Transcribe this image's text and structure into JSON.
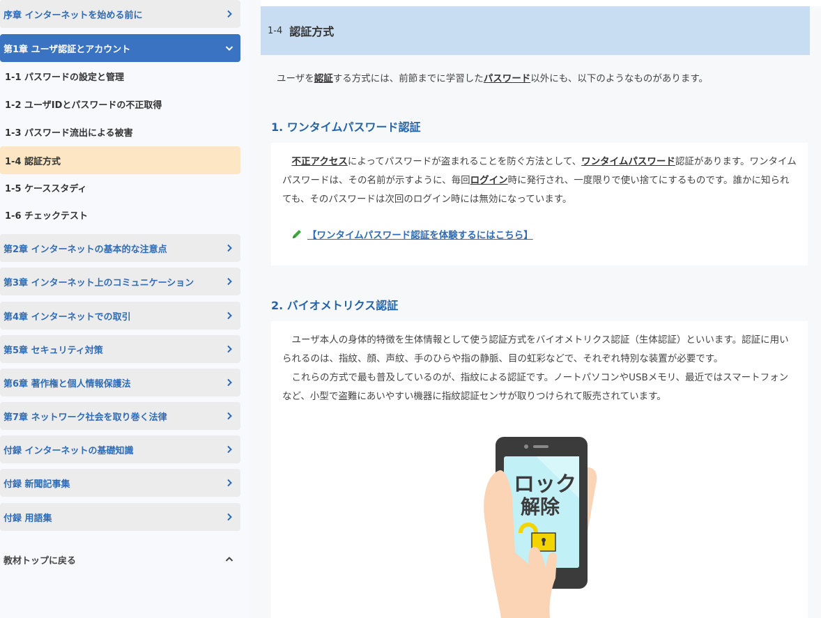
{
  "sidebar": {
    "chapters_top": [
      {
        "label": "序章 インターネットを始める前に"
      },
      {
        "label": "第1章 ユーザ認証とアカウント"
      }
    ],
    "sections": [
      {
        "label": "1-1 パスワードの設定と管理"
      },
      {
        "label": "1-2 ユーザIDとパスワードの不正取得"
      },
      {
        "label": "1-3 パスワード流出による被害"
      },
      {
        "label": "1-4 認証方式"
      },
      {
        "label": "1-5 ケーススタディ"
      },
      {
        "label": "1-6 チェックテスト"
      }
    ],
    "chapters_bottom": [
      {
        "label": "第2章 インターネットの基本的な注意点"
      },
      {
        "label": "第3章 インターネット上のコミュニケーション"
      },
      {
        "label": "第4章 インターネットでの取引"
      },
      {
        "label": "第5章 セキュリティ対策"
      },
      {
        "label": "第6章 著作権と個人情報保護法"
      },
      {
        "label": "第7章 ネットワーク社会を取り巻く法律"
      },
      {
        "label": "付録 インターネットの基礎知識"
      },
      {
        "label": "付録 新聞記事集"
      },
      {
        "label": "付録 用語集"
      }
    ],
    "back_label": "教材トップに戻る"
  },
  "header": {
    "number": "1-4",
    "title": "認証方式"
  },
  "intro": {
    "pre": "ユーザを",
    "term1": "認証",
    "mid": "する方式には、前節までに学習した",
    "term2": "パスワード",
    "post": "以外にも、以下のようなものがあります。"
  },
  "section1": {
    "heading": "1. ワンタイムパスワード認証",
    "t1": "不正アクセス",
    "s1": "によってパスワードが盗まれることを防ぐ方法として、",
    "t2": "ワンタイムパスワード",
    "s2": "認証があります。ワンタイムパスワードは、その名前が示すように、毎回",
    "t3": "ログイン",
    "s3": "時に発行され、一度限りで使い捨てにするものです。誰かに知られても、そのパスワードは次回のログイン時には無効になっています。",
    "link": "【ワンタイムパスワード認証を体験するにはこちら】"
  },
  "section2": {
    "heading": "2. バイオメトリクス認証",
    "p1": "ユーザ本人の身体的特徴を生体情報として使う認証方式をバイオメトリクス認証（生体認証）といいます。認証に用いられるのは、指紋、顔、声紋、手のひらや指の静脈、目の虹彩などで、それぞれ特別な装置が必要です。",
    "p2": "これらの方式で最も普及しているのが、指紋による認証です。ノートパソコンやUSBメモリ、最近ではスマートフォンなど、小型で盗難にあいやすい機器に指紋認証センサが取りつけられて販売されています。"
  },
  "illustration": {
    "line1": "ロック",
    "line2": "解除"
  },
  "colors": {
    "accent": "#3a73c2",
    "header_bg": "#c8ddf2",
    "current_item": "#fde6c4",
    "heading_blue": "#2563a8"
  }
}
